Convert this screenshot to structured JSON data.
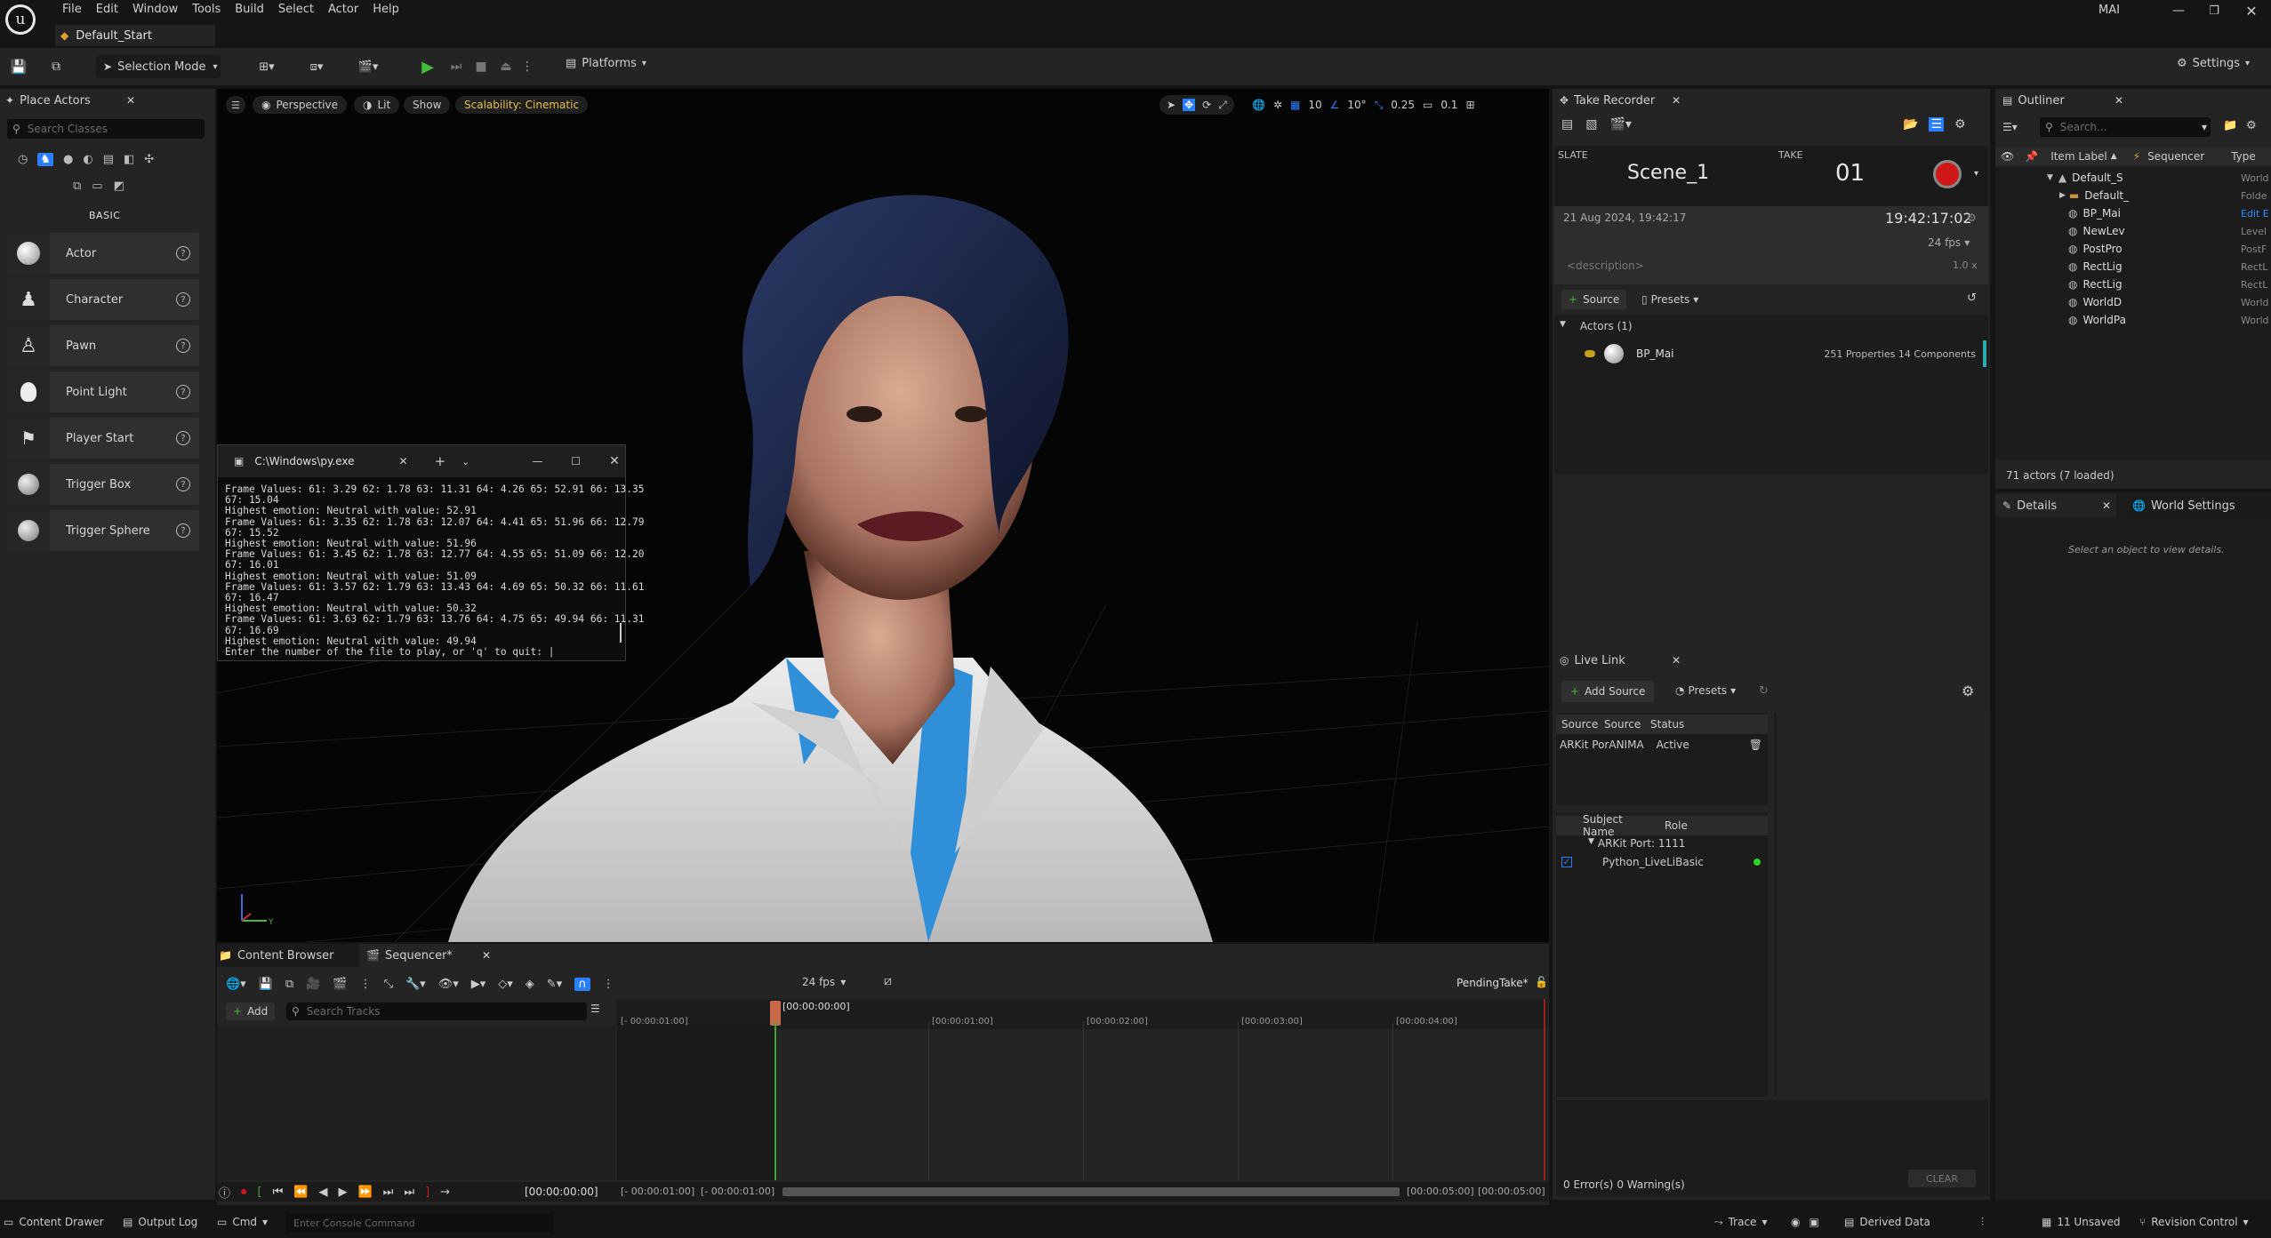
{
  "menu": {
    "items": [
      "File",
      "Edit",
      "Window",
      "Tools",
      "Build",
      "Select",
      "Actor",
      "Help"
    ],
    "project_name": "MAI",
    "level_tab": "Default_Start"
  },
  "toolbar": {
    "selection_mode": "Selection Mode",
    "platforms": "Platforms",
    "settings": "Settings"
  },
  "place_actors": {
    "title": "Place Actors",
    "search_placeholder": "Search Classes",
    "category": "BASIC",
    "items": [
      "Actor",
      "Character",
      "Pawn",
      "Point Light",
      "Player Start",
      "Trigger Box",
      "Trigger Sphere"
    ]
  },
  "viewport": {
    "perspective": "Perspective",
    "lit": "Lit",
    "show": "Show",
    "scalability": "Scalability: Cinematic",
    "grid_value": "10",
    "angle_value": "10°",
    "scale_value": "0.25",
    "camera_speed": "0.1"
  },
  "console_window": {
    "title": "C:\\Windows\\py.exe",
    "lines": [
      "Frame Values: 61: 3.29 62: 1.78 63: 11.31 64: 4.26 65: 52.91 66: 13.35",
      "67: 15.04",
      "Highest emotion: Neutral with value: 52.91",
      "Frame Values: 61: 3.35 62: 1.78 63: 12.07 64: 4.41 65: 51.96 66: 12.79",
      "67: 15.52",
      "Highest emotion: Neutral with value: 51.96",
      "Frame Values: 61: 3.45 62: 1.78 63: 12.77 64: 4.55 65: 51.09 66: 12.20",
      "67: 16.01",
      "Highest emotion: Neutral with value: 51.09",
      "Frame Values: 61: 3.57 62: 1.79 63: 13.43 64: 4.69 65: 50.32 66: 11.61",
      "67: 16.47",
      "Highest emotion: Neutral with value: 50.32",
      "Frame Values: 61: 3.63 62: 1.79 63: 13.76 64: 4.75 65: 49.94 66: 11.31",
      "67: 16.69",
      "Highest emotion: Neutral with value: 49.94",
      "Enter the number of the file to play, or 'q' to quit: |"
    ]
  },
  "take_recorder": {
    "title": "Take Recorder",
    "slate_label": "SLATE",
    "take_label": "TAKE",
    "slate": "Scene_1",
    "take": "01",
    "date": "21 Aug 2024, 19:42:17",
    "time": "19:42:17:02",
    "fps": "24 fps",
    "description_placeholder": "<description>",
    "speed": "1.0 x",
    "source_button": "Source",
    "presets_button": "Presets",
    "actors_header": "Actors (1)",
    "actor_name": "BP_Mai",
    "actor_info": "251 Properties 14 Components"
  },
  "live_link": {
    "title": "Live Link",
    "add_source": "Add Source",
    "presets": "Presets",
    "source_headers": [
      "Source",
      "Source",
      "Status"
    ],
    "source_row": [
      "ARKit Por",
      "ANIMA",
      "Active"
    ],
    "subject_headers": [
      "Subject Name",
      "Role"
    ],
    "subject_group": "ARKit Port: 1111",
    "subject_item": "Python_LiveLiBasic",
    "errors": "0 Error(s)",
    "warnings": "0 Warning(s)",
    "clear": "CLEAR"
  },
  "outliner": {
    "title": "Outliner",
    "search_placeholder": "Search...",
    "col_label": "Item Label",
    "col_sequencer": "Sequencer",
    "col_type": "Type",
    "rows": [
      {
        "label": "Default_S",
        "type": "World"
      },
      {
        "label": "Default_",
        "type": "Folde"
      },
      {
        "label": "BP_Mai",
        "type": "Edit E"
      },
      {
        "label": "NewLev",
        "type": "Level"
      },
      {
        "label": "PostPro",
        "type": "PostF"
      },
      {
        "label": "RectLig",
        "type": "RectL"
      },
      {
        "label": "RectLig",
        "type": "RectL"
      },
      {
        "label": "WorldD",
        "type": "World"
      },
      {
        "label": "WorldPa",
        "type": "World"
      }
    ],
    "actor_count": "71 actors (7 loaded)"
  },
  "details": {
    "title": "Details",
    "world_settings": "World Settings",
    "empty_message": "Select an object to view details."
  },
  "sequencer": {
    "tab_content_browser": "Content Browser",
    "tab_sequencer": "Sequencer*",
    "fps": "24 fps",
    "pending_take": "PendingTake*",
    "add": "Add",
    "search_placeholder": "Search Tracks",
    "current_time": "[00:00:00:00]",
    "timecode_display": "[00:00:00:00]",
    "tick_labels": [
      "[- 00:00:01:00]",
      "[00:00:01:00]",
      "[00:00:02:00]",
      "[00:00:03:00]",
      "[00:00:04:00]"
    ],
    "range_start_a": "[- 00:00:01:00]",
    "range_start_b": "[- 00:00:01:00]",
    "range_end_a": "[00:00:05:00]",
    "range_end_b": "[00:00:05:00]"
  },
  "statusbar": {
    "content_drawer": "Content Drawer",
    "output_log": "Output Log",
    "cmd": "Cmd",
    "console_placeholder": "Enter Console Command",
    "trace": "Trace",
    "derived_data": "Derived Data",
    "unsaved": "11 Unsaved",
    "revision_control": "Revision Control"
  },
  "colors": {
    "accent_blue": "#2a7fff",
    "record_red": "#d01818",
    "play_green": "#46b83a",
    "scalability_yellow": "#e8c048"
  }
}
